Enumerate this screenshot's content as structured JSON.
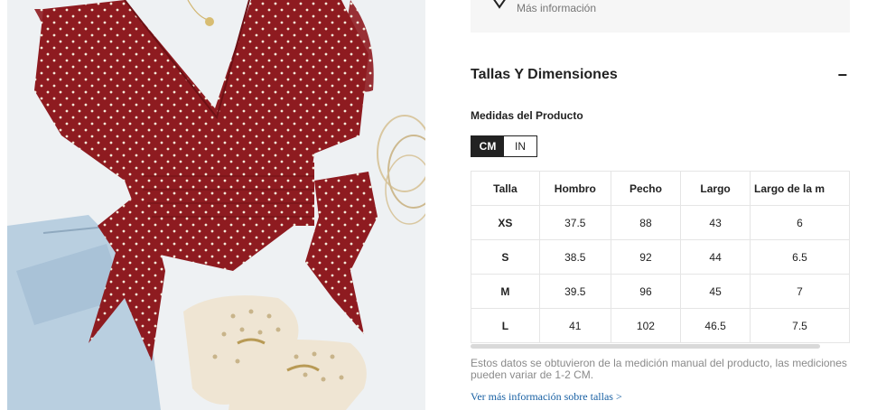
{
  "info": {
    "text": "Más información",
    "icon": "shield-icon"
  },
  "section": {
    "title": "Tallas Y Dimensiones",
    "toggle": "−"
  },
  "measure": {
    "subtitle": "Medidas del Producto",
    "units": [
      "CM",
      "IN"
    ],
    "active_unit": "CM"
  },
  "table": {
    "headers": [
      "Talla",
      "Hombro",
      "Pecho",
      "Largo",
      "Largo de la m"
    ],
    "rows": [
      [
        "XS",
        "37.5",
        "88",
        "43",
        "6"
      ],
      [
        "S",
        "38.5",
        "92",
        "44",
        "6.5"
      ],
      [
        "M",
        "39.5",
        "96",
        "45",
        "7"
      ],
      [
        "L",
        "41",
        "102",
        "46.5",
        "7.5"
      ]
    ]
  },
  "note": "Estos datos se obtuvieron de la medición manual del producto, las mediciones pueden variar de 1-2 CM.",
  "more_link": "Ver más información sobre tallas >",
  "colors": {
    "accent": "#222222",
    "link": "#1860a3",
    "blouse": "#8e1b20",
    "panel_bg": "#f6f6f6"
  }
}
